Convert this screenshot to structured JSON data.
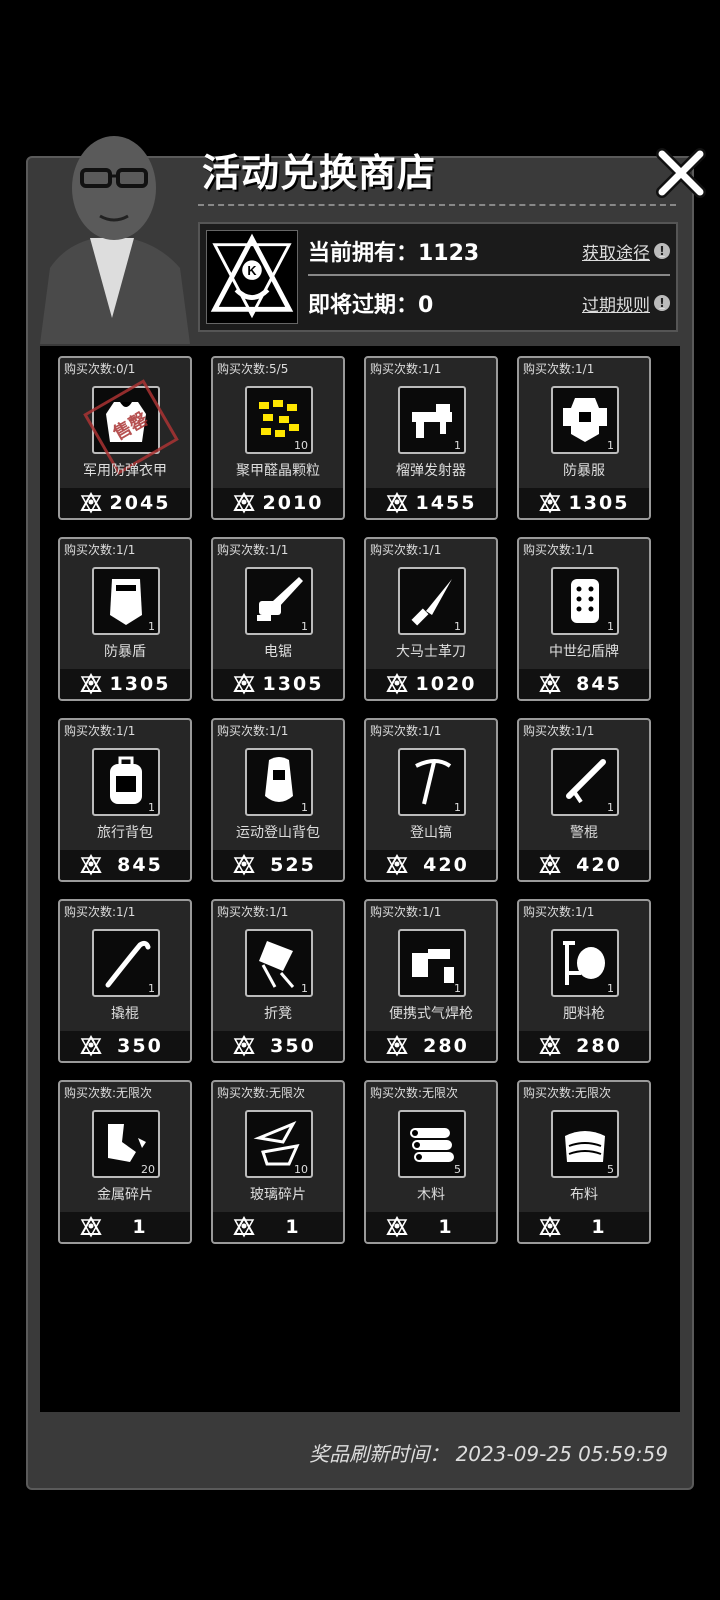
{
  "header": {
    "title": "活动兑换商店",
    "owned_label": "当前拥有：1123",
    "expiring_label": "即将过期：0",
    "get_route_link": "获取途径",
    "expire_rules_link": "过期规则"
  },
  "colors": {
    "background": "#000000",
    "panel": "#3a3a3a",
    "card_border": "#9a9a9a",
    "stamp": "#aa3333"
  },
  "items": [
    {
      "limit": "购买次数:0/1",
      "name": "军用防弹衣甲",
      "qty": "",
      "price": "2045",
      "icon": "vest-icon",
      "sold_out": true,
      "stamp_text": "售罄"
    },
    {
      "limit": "购买次数:5/5",
      "name": "聚甲醛晶颗粒",
      "qty": "10",
      "price": "2010",
      "icon": "pellets-icon",
      "sold_out": false
    },
    {
      "limit": "购买次数:1/1",
      "name": "榴弹发射器",
      "qty": "1",
      "price": "1455",
      "icon": "launcher-icon",
      "sold_out": false
    },
    {
      "limit": "购买次数:1/1",
      "name": "防暴服",
      "qty": "1",
      "price": "1305",
      "icon": "riot-suit-icon",
      "sold_out": false
    },
    {
      "limit": "购买次数:1/1",
      "name": "防暴盾",
      "qty": "1",
      "price": "1305",
      "icon": "riot-shield-icon",
      "sold_out": false
    },
    {
      "limit": "购买次数:1/1",
      "name": "电锯",
      "qty": "1",
      "price": "1305",
      "icon": "chainsaw-icon",
      "sold_out": false
    },
    {
      "limit": "购买次数:1/1",
      "name": "大马士革刀",
      "qty": "1",
      "price": "1020",
      "icon": "knife-icon",
      "sold_out": false
    },
    {
      "limit": "购买次数:1/1",
      "name": "中世纪盾牌",
      "qty": "1",
      "price": "845",
      "icon": "medieval-shield-icon",
      "sold_out": false
    },
    {
      "limit": "购买次数:1/1",
      "name": "旅行背包",
      "qty": "1",
      "price": "845",
      "icon": "backpack-icon",
      "sold_out": false
    },
    {
      "limit": "购买次数:1/1",
      "name": "运动登山背包",
      "qty": "1",
      "price": "525",
      "icon": "hiking-backpack-icon",
      "sold_out": false
    },
    {
      "limit": "购买次数:1/1",
      "name": "登山镐",
      "qty": "1",
      "price": "420",
      "icon": "ice-axe-icon",
      "sold_out": false
    },
    {
      "limit": "购买次数:1/1",
      "name": "警棍",
      "qty": "1",
      "price": "420",
      "icon": "baton-icon",
      "sold_out": false
    },
    {
      "limit": "购买次数:1/1",
      "name": "撬棍",
      "qty": "1",
      "price": "350",
      "icon": "crowbar-icon",
      "sold_out": false
    },
    {
      "limit": "购买次数:1/1",
      "name": "折凳",
      "qty": "1",
      "price": "350",
      "icon": "folding-chair-icon",
      "sold_out": false
    },
    {
      "limit": "购买次数:1/1",
      "name": "便携式气焊枪",
      "qty": "1",
      "price": "280",
      "icon": "torch-icon",
      "sold_out": false
    },
    {
      "limit": "购买次数:1/1",
      "name": "肥料枪",
      "qty": "1",
      "price": "280",
      "icon": "fertilizer-gun-icon",
      "sold_out": false
    },
    {
      "limit": "购买次数:无限次",
      "name": "金属碎片",
      "qty": "20",
      "price": "1",
      "icon": "metal-scrap-icon",
      "sold_out": false
    },
    {
      "limit": "购买次数:无限次",
      "name": "玻璃碎片",
      "qty": "10",
      "price": "1",
      "icon": "glass-shard-icon",
      "sold_out": false
    },
    {
      "limit": "购买次数:无限次",
      "name": "木料",
      "qty": "5",
      "price": "1",
      "icon": "wood-icon",
      "sold_out": false
    },
    {
      "limit": "购买次数:无限次",
      "name": "布料",
      "qty": "5",
      "price": "1",
      "icon": "cloth-icon",
      "sold_out": false
    }
  ],
  "footer": {
    "refresh_text": "奖品刷新时间： 2023-09-25 05:59:59"
  }
}
